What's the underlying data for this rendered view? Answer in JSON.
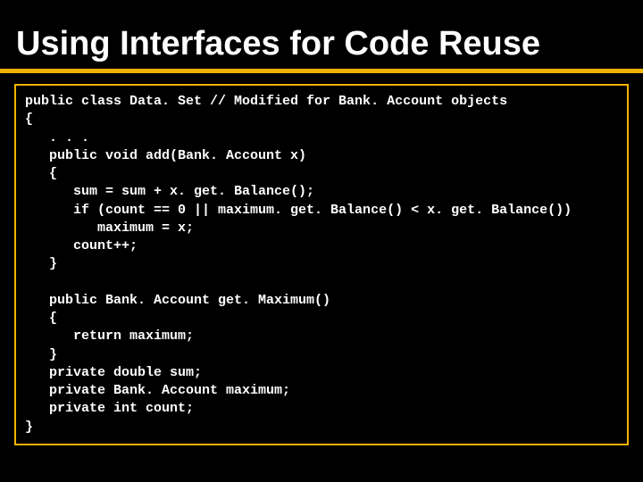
{
  "slide": {
    "title": "Using Interfaces for Code Reuse",
    "code": "public class Data. Set // Modified for Bank. Account objects\n{\n   . . .\n   public void add(Bank. Account x)\n   {\n      sum = sum + x. get. Balance();\n      if (count == 0 || maximum. get. Balance() < x. get. Balance())\n         maximum = x;\n      count++;\n   }\n\n   public Bank. Account get. Maximum()\n   {\n      return maximum;\n   }\n   private double sum;\n   private Bank. Account maximum;\n   private int count;\n}"
  }
}
